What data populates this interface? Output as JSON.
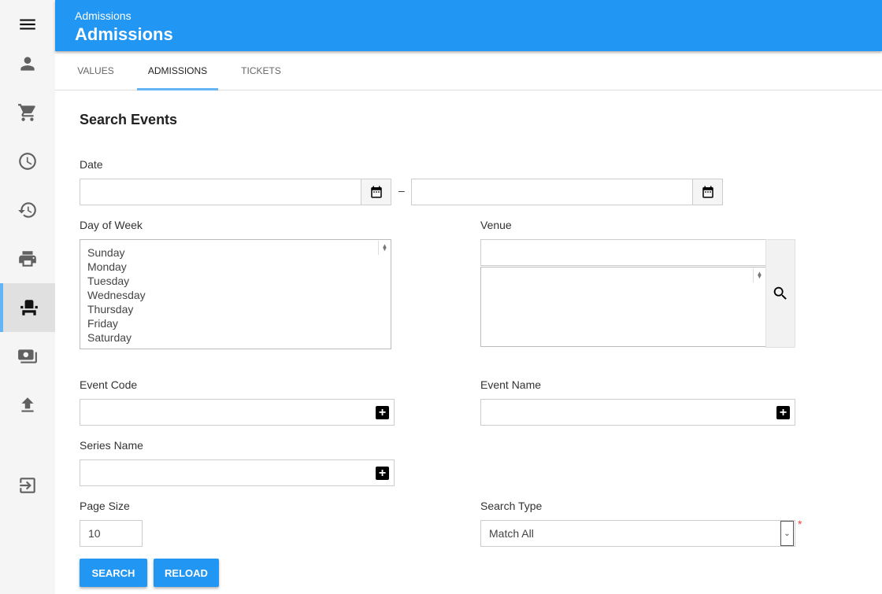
{
  "sidebar": {
    "items": [
      {
        "icon": "menu-icon"
      },
      {
        "icon": "person-icon"
      },
      {
        "icon": "cart-icon"
      },
      {
        "icon": "clock-icon"
      },
      {
        "icon": "history-icon"
      },
      {
        "icon": "print-icon"
      },
      {
        "icon": "seat-icon",
        "active": true
      },
      {
        "icon": "money-icon"
      },
      {
        "icon": "upload-icon"
      },
      {
        "icon": "exit-icon"
      }
    ]
  },
  "header": {
    "subtitle": "Admissions",
    "title": "Admissions",
    "color": "#2196f3"
  },
  "tabs": [
    {
      "label": "VALUES"
    },
    {
      "label": "ADMISSIONS",
      "active": true
    },
    {
      "label": "TICKETS"
    }
  ],
  "form": {
    "heading": "Search Events",
    "date_label": "Date",
    "date_from": "",
    "date_to": "",
    "date_sep": "–",
    "dow_label": "Day of Week",
    "days": [
      "Sunday",
      "Monday",
      "Tuesday",
      "Wednesday",
      "Thursday",
      "Friday",
      "Saturday"
    ],
    "venue_label": "Venue",
    "venue_value": "",
    "event_code_label": "Event Code",
    "event_name_label": "Event Name",
    "series_name_label": "Series Name",
    "page_size_label": "Page Size",
    "page_size_value": "10",
    "search_type_label": "Search Type",
    "search_type_value": "Match All",
    "required_mark": "*",
    "search_button": "SEARCH",
    "reload_button": "RELOAD"
  }
}
